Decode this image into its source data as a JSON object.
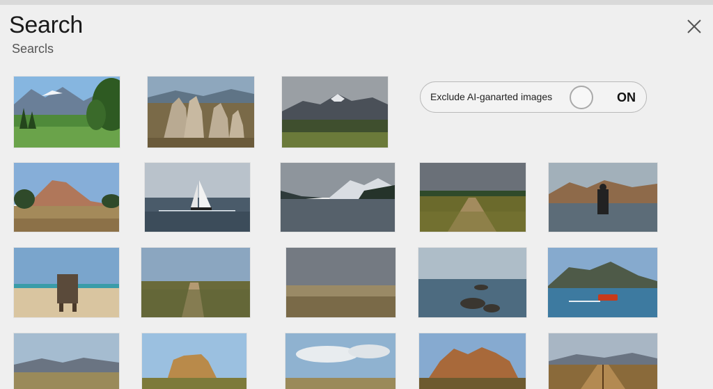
{
  "header": {
    "title": "Search",
    "subtitle": "Searcls"
  },
  "filter": {
    "label": "Exclude AI-ganarted images",
    "state": "ON"
  },
  "icons": {
    "close": "close-icon"
  },
  "colors": {
    "background": "#efefef",
    "pill_border": "#b9b9b9"
  }
}
